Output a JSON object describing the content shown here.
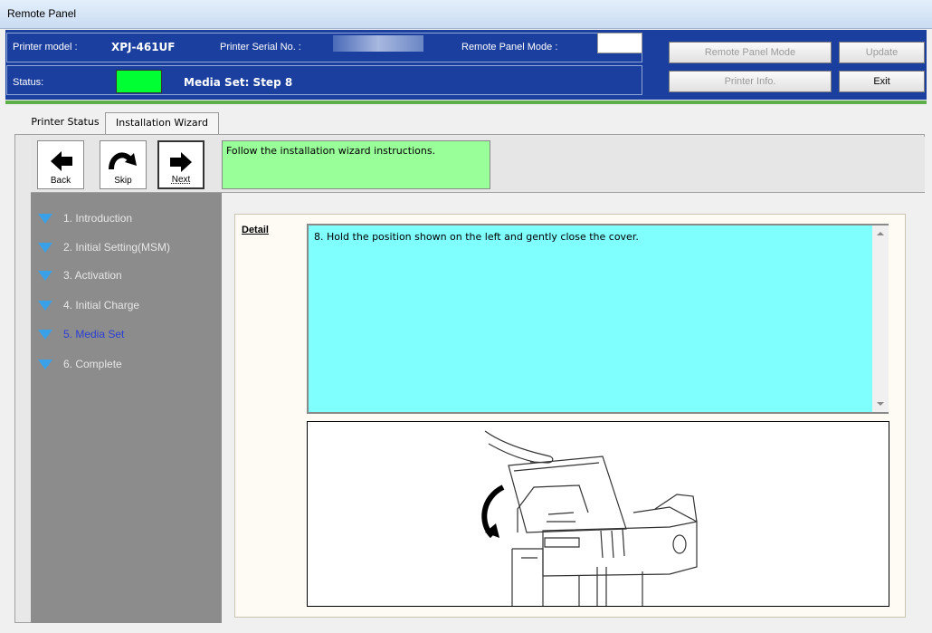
{
  "window": {
    "title": "Remote Panel"
  },
  "header": {
    "printer_model_label": "Printer model :",
    "printer_model_value": "XPJ-461UF",
    "serial_label": "Printer Serial No. :",
    "remote_mode_label": "Remote Panel Mode :",
    "status_label": "Status:",
    "status_text": "Media Set: Step 8",
    "status_color": "#00ff33",
    "buttons": {
      "remote_panel_mode": "Remote Panel Mode",
      "update": "Update",
      "printer_info": "Printer Info.",
      "exit": "Exit"
    }
  },
  "tabs": [
    {
      "label": "Printer Status"
    },
    {
      "label": "Installation Wizard"
    }
  ],
  "toolbar": {
    "back_label": "Back",
    "skip_label": "Skip",
    "next_label": "Next",
    "message": "Follow the installation wizard instructions."
  },
  "steps": [
    {
      "label": "1. Introduction"
    },
    {
      "label": "2. Initial Setting(MSM)"
    },
    {
      "label": "3. Activation"
    },
    {
      "label": "4. Initial Charge"
    },
    {
      "label": "5. Media Set"
    },
    {
      "label": "6. Complete"
    }
  ],
  "detail": {
    "title": "Detail",
    "text": "8. Hold the position shown on the left and gently close the cover."
  },
  "colors": {
    "header_bg": "#1b3f9e",
    "message_bg": "#99ff99",
    "detail_bg": "#80ffff",
    "active_step": "#2b3fd3"
  }
}
